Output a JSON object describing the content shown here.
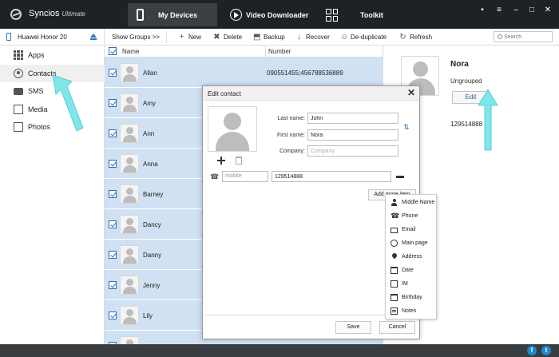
{
  "app": {
    "name": "Syncios",
    "edition": "Ultimate"
  },
  "nav": {
    "tabs": [
      {
        "label": "My Devices"
      },
      {
        "label": "Video Downloader"
      },
      {
        "label": "Toolkit"
      }
    ]
  },
  "window_controls": {
    "chat": "▪",
    "menu": "≡",
    "minimize": "–",
    "maximize": "□",
    "close": "✕"
  },
  "device": {
    "name": "Huawei Honor 20"
  },
  "toolbar": {
    "show_groups": "Show Groups >>",
    "new": "New",
    "delete": "Delete",
    "backup": "Backup",
    "recover": "Recover",
    "deduplicate": "De-duplicate",
    "refresh": "Refresh",
    "search_placeholder": "Search"
  },
  "sidebar": {
    "items": [
      {
        "label": "Apps",
        "icon": "apps-icon"
      },
      {
        "label": "Contacts",
        "icon": "contacts-icon",
        "active": true
      },
      {
        "label": "SMS",
        "icon": "sms-icon"
      },
      {
        "label": "Media",
        "icon": "media-icon"
      },
      {
        "label": "Photos",
        "icon": "photos-icon"
      }
    ]
  },
  "list": {
    "columns": {
      "name": "Name",
      "number": "Number"
    },
    "rows": [
      {
        "name": "Allan",
        "number": "090551455;456788536889"
      },
      {
        "name": "Amy",
        "number": ""
      },
      {
        "name": "Ann",
        "number": ""
      },
      {
        "name": "Anna",
        "number": ""
      },
      {
        "name": "Barney",
        "number": ""
      },
      {
        "name": "Dancy",
        "number": ""
      },
      {
        "name": "Danny",
        "number": ""
      },
      {
        "name": "Jenny",
        "number": ""
      },
      {
        "name": "Lily",
        "number": ""
      },
      {
        "name": "",
        "number": ""
      }
    ]
  },
  "detail": {
    "name": "Nora",
    "group": "Ungrouped",
    "edit_label": "Edit",
    "phone": "129514888"
  },
  "dialog": {
    "title": "Edit contact",
    "last_name_label": "Last name:",
    "last_name_value": "John",
    "first_name_label": "First name:",
    "first_name_value": "Nora",
    "company_label": "Company:",
    "company_placeholder": "Company",
    "phone_type": "mobile",
    "phone_value": "129514888",
    "add_more_label": "Add more item",
    "save_label": "Save",
    "cancel_label": "Cancel"
  },
  "add_item_menu": {
    "items": [
      {
        "label": "Middle Name",
        "icon": "person-icon"
      },
      {
        "label": "Phone",
        "icon": "phone-icon"
      },
      {
        "label": "Email",
        "icon": "email-icon"
      },
      {
        "label": "Main page",
        "icon": "globe-icon"
      },
      {
        "label": "Address",
        "icon": "pin-icon"
      },
      {
        "label": "Date",
        "icon": "calendar-icon"
      },
      {
        "label": "IM",
        "icon": "im-icon"
      },
      {
        "label": "Birthday",
        "icon": "birthday-icon"
      },
      {
        "label": "Notes",
        "icon": "notes-icon"
      }
    ]
  },
  "social": {
    "facebook": "f",
    "twitter": "t"
  },
  "colors": {
    "titlebar": "#1f2225",
    "selected_row": "#cfe1f3",
    "accent": "#2a6fb3",
    "callout_arrow": "#7fe6ea"
  }
}
